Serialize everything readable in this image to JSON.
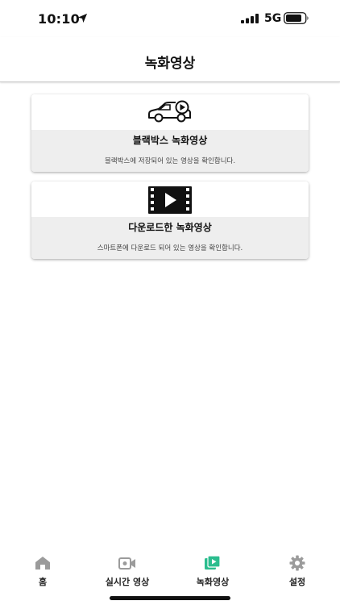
{
  "status_bar": {
    "time": "10:10",
    "network": "5G"
  },
  "header": {
    "title": "녹화영상"
  },
  "cards": [
    {
      "icon": "car-play-icon",
      "title": "블랙박스 녹화영상",
      "description": "블랙박스에 저장되어 있는 영상을 확인합니다."
    },
    {
      "icon": "film-play-icon",
      "title": "다운로드한 녹화영상",
      "description": "스마트폰에 다운로드 되어 있는 영상을 확인합니다."
    }
  ],
  "tab_bar": {
    "tabs": [
      {
        "label": "홈",
        "icon": "home-icon",
        "active": false
      },
      {
        "label": "실시간 영상",
        "icon": "video-camera-icon",
        "active": false
      },
      {
        "label": "녹화영상",
        "icon": "video-library-icon",
        "active": true
      },
      {
        "label": "설정",
        "icon": "gear-icon",
        "active": false
      }
    ]
  },
  "colors": {
    "accent": "#2bbd8e",
    "inactive_icon": "#9b9b9b",
    "card_bottom_bg": "#eeeeee"
  }
}
